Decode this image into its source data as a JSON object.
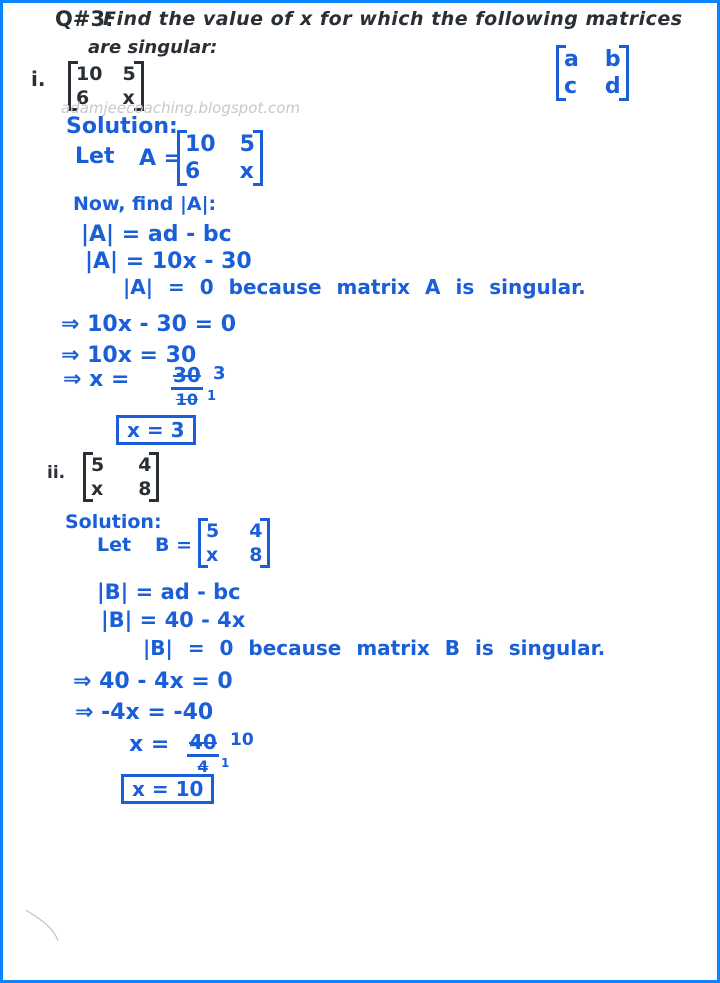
{
  "question": {
    "label": "Q#3:",
    "text_line1": "Find the value of x for which the following matrices",
    "text_line2": "are singular:"
  },
  "reference_matrix": {
    "a": "a",
    "b": "b",
    "c": "c",
    "d": "d"
  },
  "watermark": "adamjeecoaching.blogspot.com",
  "parts": [
    {
      "label": "i.",
      "matrix": {
        "a": "10",
        "b": "5",
        "c": "6",
        "d": "x"
      },
      "solution_heading": "Solution:",
      "let_text": "Let",
      "matrix_name": "A =",
      "step_find": "Now, find |A|:",
      "det_formula": "|A| = ad - bc",
      "det_value": "|A| = 10x - 30",
      "singular_reason": "|A| = 0 because matrix A is singular.",
      "steps": [
        "⇒ 10x - 30 = 0",
        "⇒ 10x = 30",
        "⇒ x ="
      ],
      "fraction": {
        "numerator": "30",
        "denominator": "10",
        "numerator_reduced": "3",
        "denominator_reduced": "1"
      },
      "answer": "x = 3"
    },
    {
      "label": "ii.",
      "matrix": {
        "a": "5",
        "b": "4",
        "c": "x",
        "d": "8"
      },
      "solution_heading": "Solution:",
      "let_text": "Let",
      "matrix_name": "B =",
      "det_formula": "|B| = ad - bc",
      "det_value": "|B| = 40 - 4x",
      "singular_reason": "|B| = 0 because matrix B is singular.",
      "steps": [
        "⇒ 40 - 4x = 0",
        "⇒ -4x = -40",
        "x ="
      ],
      "fraction": {
        "numerator": "40",
        "denominator": "4",
        "numerator_reduced": "10",
        "denominator_reduced": "1"
      },
      "answer": "x = 10"
    }
  ],
  "colors": {
    "border": "#0a84ff",
    "ink_black": "#2a2f35",
    "ink_blue": "#1a5fd8",
    "paper": "#ffffff"
  }
}
